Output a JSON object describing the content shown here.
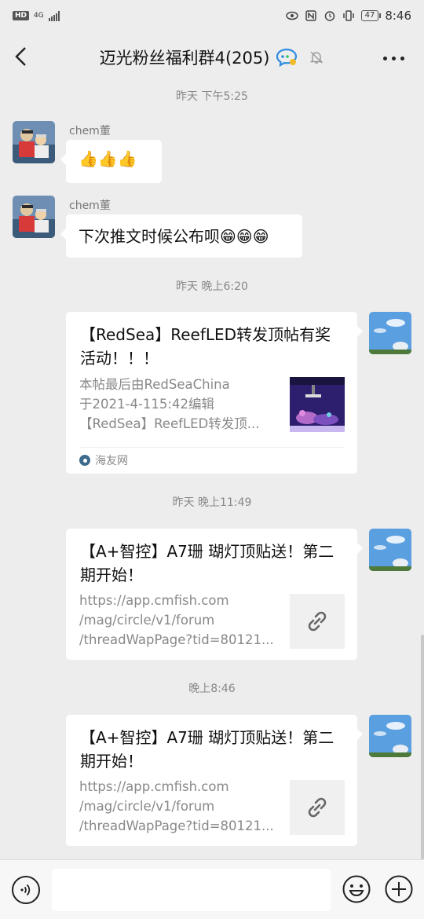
{
  "status_bar": {
    "hd_badge": "HD",
    "network": "4G",
    "time": "8:46",
    "battery": "47"
  },
  "header": {
    "title": "迈光粉丝福利群4(205)",
    "back_icon": "chevron-left-icon",
    "more_icon": "more-dots-icon"
  },
  "messages": {
    "time_1": "昨天 下午5:25",
    "msg_1": {
      "sender": "chem董",
      "text": "👍👍👍"
    },
    "msg_2": {
      "sender": "chem董",
      "text": "下次推文时候公布呗😁😁😁"
    },
    "time_2": "昨天 晚上6:20",
    "card_1": {
      "title": "【RedSea】ReefLED转发顶帖有奖活动！！！",
      "desc_lines": [
        "本帖最后由RedSeaChina",
        "于2021-4-115:42编辑",
        "【RedSea】ReefLED转发顶..."
      ],
      "source": "海友网"
    },
    "time_3": "昨天 晚上11:49",
    "card_2": {
      "title": "【A+智控】A7珊 瑚灯顶贴送！第二期开始！",
      "desc_lines": [
        "https://app.cmfish.com",
        "/mag/circle/v1/forum",
        "/threadWapPage?tid=80121..."
      ]
    },
    "time_4": "晚上8:46",
    "card_3": {
      "title": "【A+智控】A7珊 瑚灯顶贴送！第二期开始！",
      "desc_lines": [
        "https://app.cmfish.com",
        "/mag/circle/v1/forum",
        "/threadWapPage?tid=80121..."
      ]
    }
  },
  "input_bar": {
    "placeholder": "",
    "voice_icon": "voice-icon",
    "emoji_icon": "emoji-icon",
    "plus_icon": "plus-icon"
  },
  "colors": {
    "background": "#ededed",
    "bubble": "#ffffff",
    "muted_text": "#888888"
  }
}
